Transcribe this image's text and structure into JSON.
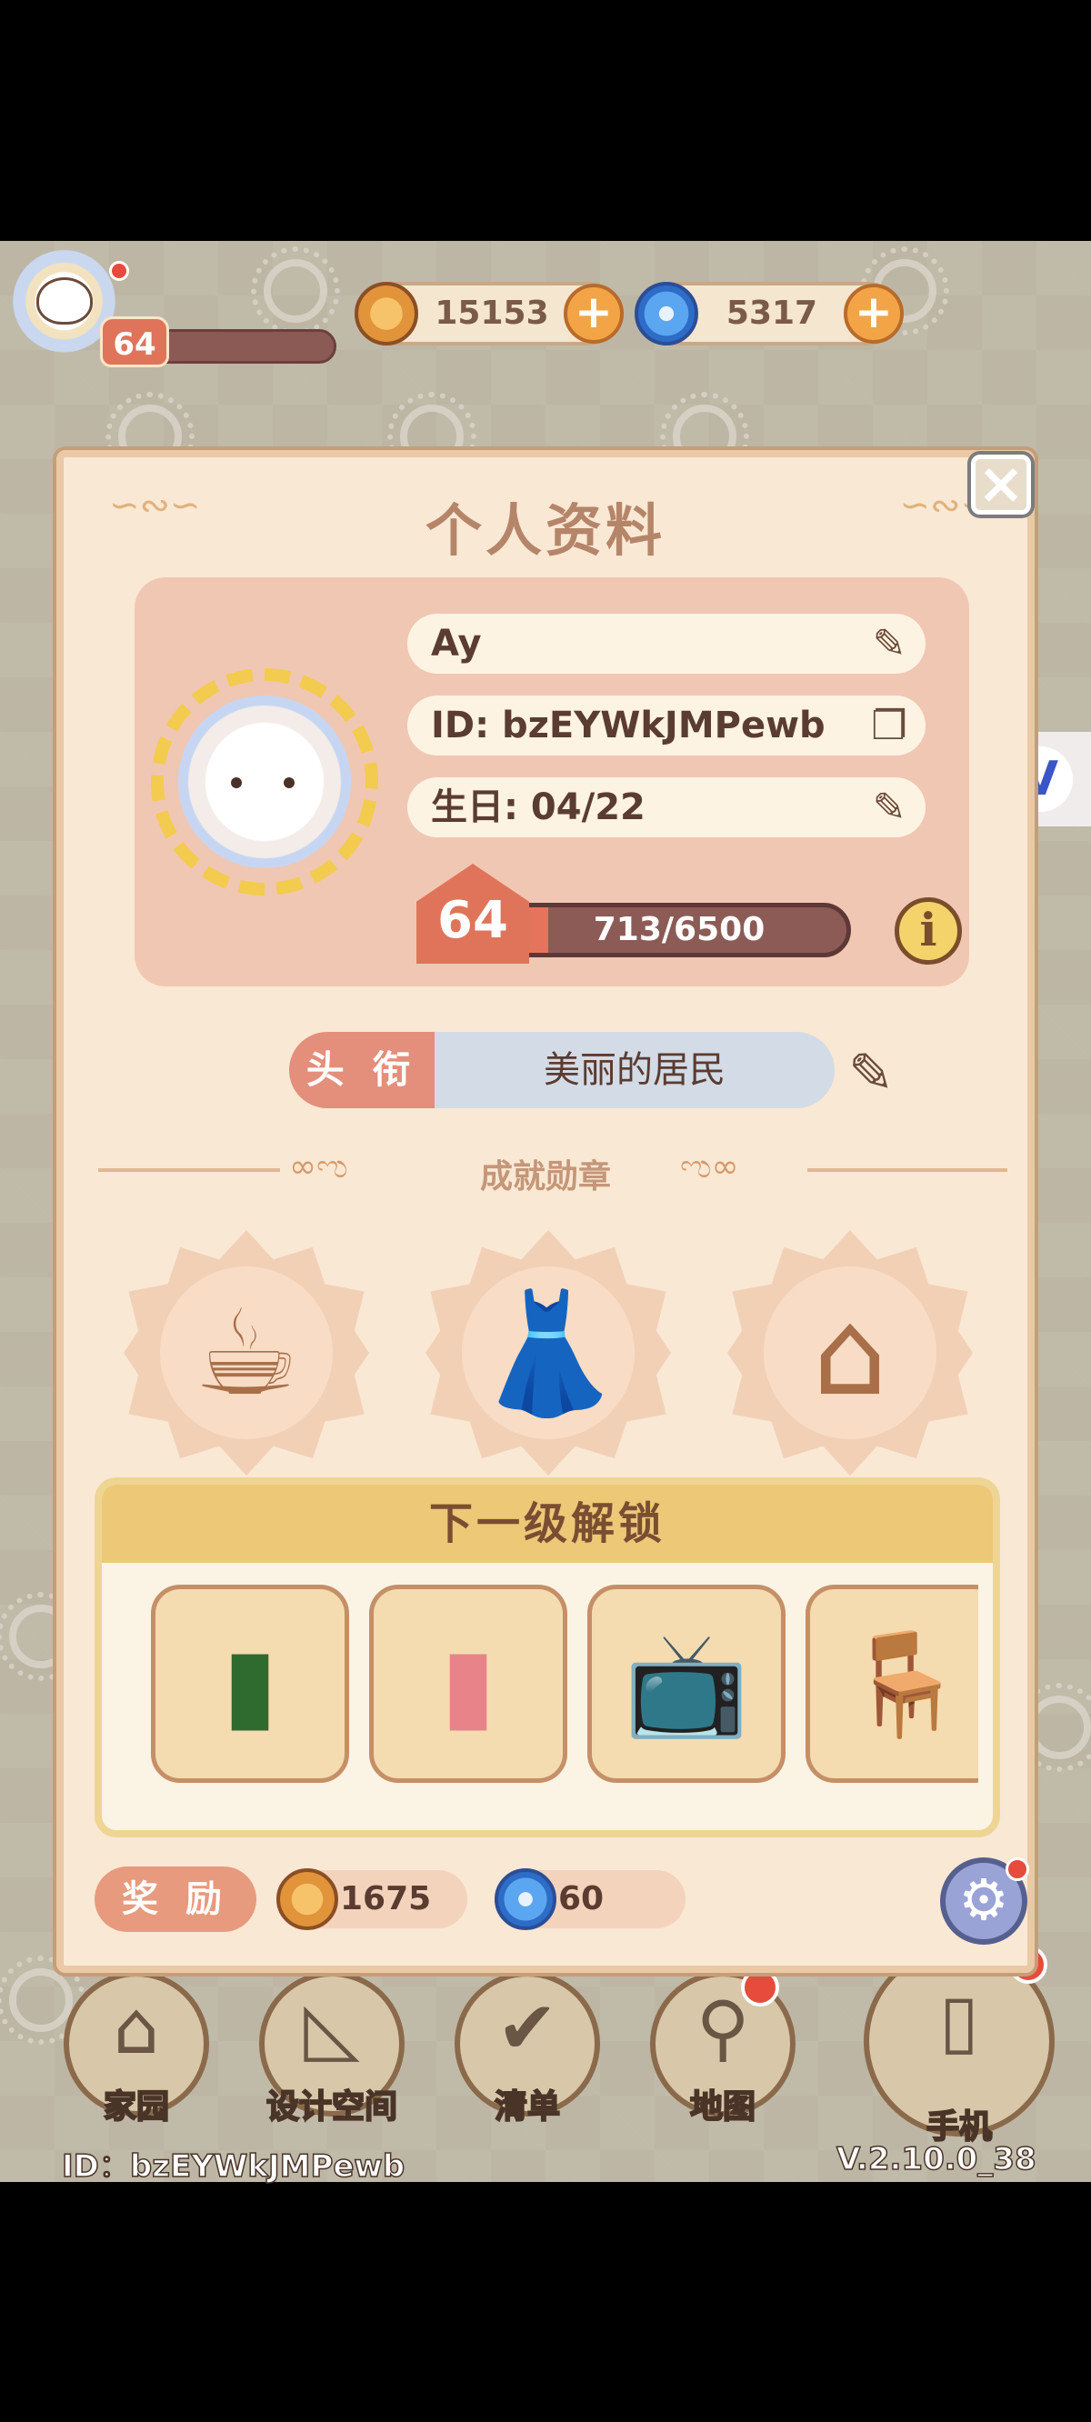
{
  "hud": {
    "player_level": "64",
    "coins": "15153",
    "gems": "5317"
  },
  "panel": {
    "title": "个人资料",
    "name": "Ay",
    "id": "ID: bzEYWkJMPewb",
    "birthday": "生日: 04/22",
    "level": "64",
    "xp_text": "713/6500",
    "xp_progress": 0.11,
    "title_label": "头 衔",
    "title_value": "美丽的居民",
    "achievements_label": "成就勋章",
    "unlock_header": "下一级解锁",
    "reward_label": "奖 励",
    "reward_coins": "1675",
    "reward_gems": "60",
    "medals": [
      "latte-medal",
      "outfit-medal",
      "house-key-medal"
    ],
    "unlock_items": [
      "green-bottle",
      "ramune-bottle",
      "retro-tv",
      "white-chair"
    ]
  },
  "nav": {
    "home": "家园",
    "design": "设计空间",
    "list": "清单",
    "map": "地图",
    "phone": "手机"
  },
  "footer": {
    "id": "ID：bzEYWkJMPewb",
    "version": "V.2.10.0_38"
  },
  "colors": {
    "panel_bg": "#f9e8d4",
    "card_bg": "#f0c7b3",
    "accent": "#e0745a",
    "unlock_header": "#ecc877"
  }
}
